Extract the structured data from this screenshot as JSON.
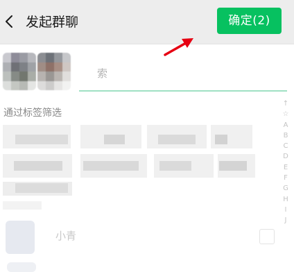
{
  "header": {
    "title": "发起群聊",
    "confirm_label": "确定(2)",
    "back_icon": "chevron-left-icon"
  },
  "search": {
    "hint": "索"
  },
  "tag_filter": {
    "label": "通过标签筛选"
  },
  "index_bar": {
    "letters": [
      "↑",
      "☆",
      "A",
      "B",
      "C",
      "D",
      "E",
      "F",
      "G",
      "H",
      "I",
      "J"
    ]
  },
  "contact": {
    "name": "小青"
  },
  "colors": {
    "accent": "#07c160",
    "header_bg": "#ededed",
    "search_underline": "#9fe0c3",
    "annotation_arrow": "#e60012"
  }
}
